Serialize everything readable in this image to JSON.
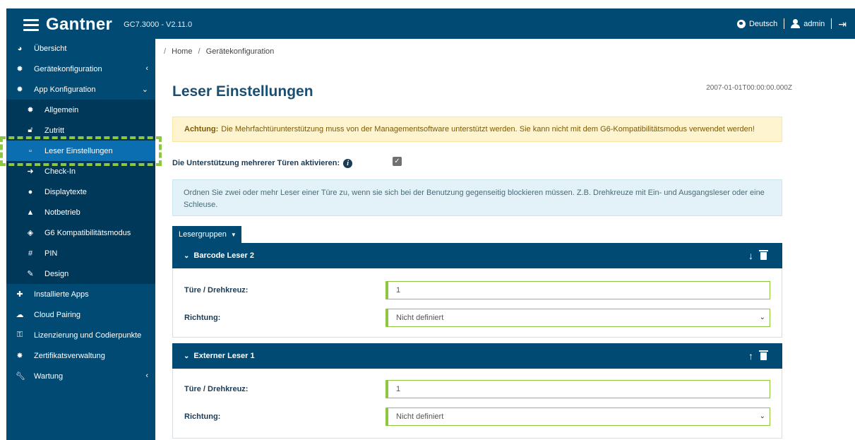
{
  "header": {
    "brand": "Gantner",
    "version": "GC7.3000 - V2.11.0",
    "language": "Deutsch",
    "user": "admin",
    "icons": {
      "menu": "hamburger-icon",
      "language": "globe-icon",
      "user": "user-icon",
      "logout": "sign-out-icon"
    }
  },
  "sidebar": {
    "items": [
      {
        "label": "Übersicht",
        "icon": "pie-chart-icon"
      },
      {
        "label": "Gerätekonfiguration",
        "icon": "gear-icon",
        "chevron": "left"
      },
      {
        "label": "App Konfiguration",
        "icon": "gears-icon",
        "chevron": "down"
      }
    ],
    "sub_items": [
      {
        "label": "Allgemein",
        "icon": "gear-icon"
      },
      {
        "label": "Zutritt",
        "icon": "unlock-icon"
      },
      {
        "label": "Leser Einstellungen",
        "icon": "square-icon",
        "active": true
      },
      {
        "label": "Check-In",
        "icon": "sign-in-icon"
      },
      {
        "label": "Displaytexte",
        "icon": "comment-icon"
      },
      {
        "label": "Notbetrieb",
        "icon": "warning-icon"
      },
      {
        "label": "G6 Kompatibilitätsmodus",
        "icon": "cube-icon"
      },
      {
        "label": "PIN",
        "icon": "hashtag-icon"
      },
      {
        "label": "Design",
        "icon": "brush-icon"
      }
    ],
    "bottom_items": [
      {
        "label": "Installierte Apps",
        "icon": "puzzle-icon"
      },
      {
        "label": "Cloud Pairing",
        "icon": "cloud-icon"
      },
      {
        "label": "Lizenzierung und Codierpunkte",
        "icon": "key-icon"
      },
      {
        "label": "Zertifikatsverwaltung",
        "icon": "certificate-icon"
      },
      {
        "label": "Wartung",
        "icon": "wrench-icon",
        "chevron": "left"
      }
    ]
  },
  "breadcrumb": {
    "home": "Home",
    "current": "Gerätekonfiguration"
  },
  "page": {
    "title": "Leser Einstellungen",
    "timestamp": "2007-01-01T00:00:00.000Z"
  },
  "warning": {
    "label": "Achtung:",
    "text": "Die Mehrfachtürunterstützung muss von der Managementsoftware unterstützt werden. Sie kann nicht mit dem G6-Kompatibilitätsmodus verwendet werden!"
  },
  "multi_door": {
    "label": "Die Unterstützung mehrerer Türen aktivieren:",
    "checked": true
  },
  "info_text": "Ordnen Sie zwei oder mehr Leser einer Türe zu, wenn sie sich bei der Benutzung gegenseitig blockieren müssen. Z.B. Drehkreuze mit Ein- und Ausgangsleser oder eine Schleuse.",
  "reader_groups_button": "Lesergruppen",
  "groups": [
    {
      "title": "Barcode Leser 2",
      "move": "down",
      "door_label": "Türe / Drehkreuz:",
      "door_value": "1",
      "direction_label": "Richtung:",
      "direction_value": "Nicht definiert"
    },
    {
      "title": "Externer Leser 1",
      "move": "up",
      "door_label": "Türe / Drehkreuz:",
      "door_value": "1",
      "direction_label": "Richtung:",
      "direction_value": "Nicht definiert"
    }
  ],
  "colors": {
    "primary": "#004a73",
    "active": "#0a6eb0",
    "highlight": "#8dc63f",
    "warning_bg": "#fff4d0",
    "info_bg": "#e2f2f8"
  }
}
